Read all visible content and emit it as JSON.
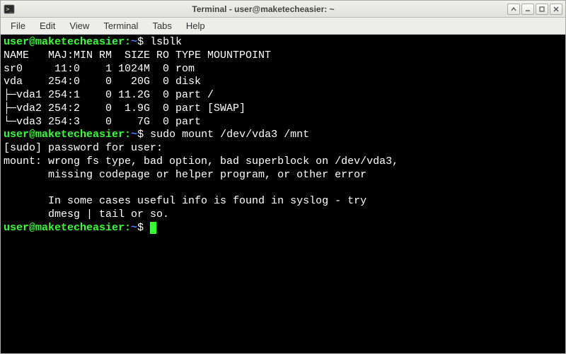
{
  "window": {
    "title": "Terminal - user@maketecheasier: ~"
  },
  "menu": {
    "file": "File",
    "edit": "Edit",
    "view": "View",
    "terminal": "Terminal",
    "tabs": "Tabs",
    "help": "Help"
  },
  "term": {
    "prompt_user": "user@maketecheasier",
    "prompt_sep": ":",
    "prompt_path": "~",
    "prompt_end": "$ ",
    "cmd1": "lsblk",
    "out1_header": "NAME   MAJ:MIN RM  SIZE RO TYPE MOUNTPOINT",
    "out1_r1": "sr0     11:0    1 1024M  0 rom  ",
    "out1_r2": "vda    254:0    0   20G  0 disk ",
    "out1_r3": "├─vda1 254:1    0 11.2G  0 part /",
    "out1_r4": "├─vda2 254:2    0  1.9G  0 part [SWAP]",
    "out1_r5": "└─vda3 254:3    0    7G  0 part ",
    "cmd2": "sudo mount /dev/vda3 /mnt",
    "out2_l1": "[sudo] password for user: ",
    "out2_l2": "mount: wrong fs type, bad option, bad superblock on /dev/vda3,",
    "out2_l3": "       missing codepage or helper program, or other error",
    "out2_l4": "",
    "out2_l5": "       In some cases useful info is found in syslog - try",
    "out2_l6": "       dmesg | tail or so."
  }
}
